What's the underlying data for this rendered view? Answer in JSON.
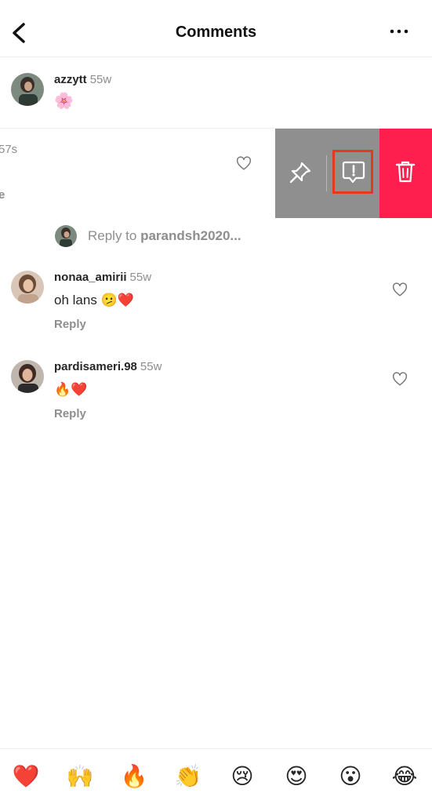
{
  "header": {
    "title": "Comments"
  },
  "caption": {
    "username": "azzytt",
    "time": "55w",
    "text": "🌸"
  },
  "swiped_comment": {
    "time_fragment": "57s",
    "text_fragment": "e"
  },
  "reply_to": {
    "prefix": "Reply to ",
    "username": "parandsh2020..."
  },
  "comments": [
    {
      "username": "nonaa_amirii",
      "time": "55w",
      "text": "oh lans 🫤❤️",
      "reply_label": "Reply"
    },
    {
      "username": "pardisameri.98",
      "time": "55w",
      "text": "🔥❤️",
      "reply_label": "Reply"
    }
  ],
  "emoji_bar": [
    "❤️",
    "🙌",
    "🔥",
    "👏",
    "😢",
    "😍",
    "😮",
    "😂"
  ],
  "colors": {
    "delete_red": "#ff1f4f",
    "action_grey": "#8f8f8f",
    "highlight": "#e5381c",
    "muted": "#8e8e8e"
  }
}
